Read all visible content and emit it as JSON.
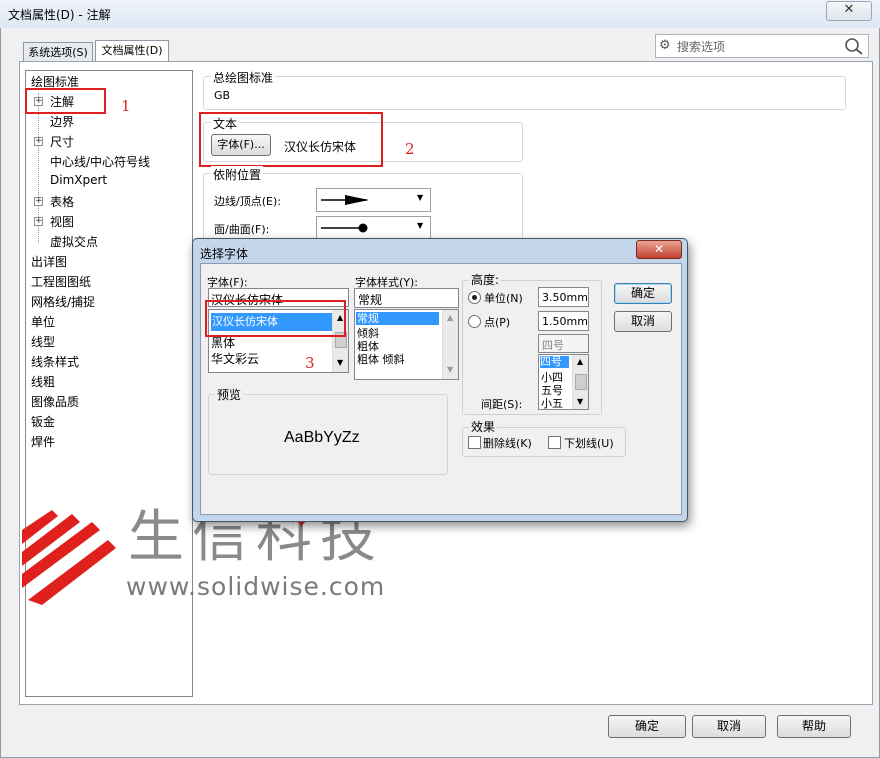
{
  "window": {
    "title": "文档属性(D) - 注解",
    "close_glyph": "✕"
  },
  "tabs": [
    {
      "label": "系统选项(S)"
    },
    {
      "label": "文档属性(D)"
    }
  ],
  "search": {
    "placeholder": "搜索选项"
  },
  "tree": {
    "items": [
      {
        "label": "绘图标准"
      },
      {
        "label": "注解"
      },
      {
        "label": "边界"
      },
      {
        "label": "尺寸"
      },
      {
        "label": "中心线/中心符号线"
      },
      {
        "label": "DimXpert"
      },
      {
        "label": "表格"
      },
      {
        "label": "视图"
      },
      {
        "label": "虚拟交点"
      },
      {
        "label": "出详图"
      },
      {
        "label": "工程图图纸"
      },
      {
        "label": "网格线/捕捉"
      },
      {
        "label": "单位"
      },
      {
        "label": "线型"
      },
      {
        "label": "线条样式"
      },
      {
        "label": "线粗"
      },
      {
        "label": "图像品质"
      },
      {
        "label": "钣金"
      },
      {
        "label": "焊件"
      }
    ]
  },
  "overall_standard": {
    "label": "总绘图标准",
    "value": "GB"
  },
  "text_group": {
    "label": "文本",
    "font_button": "字体(F)...",
    "font_name": "汉仪长仿宋体"
  },
  "attach_group": {
    "label": "依附位置",
    "edge_label": "边线/顶点(E):",
    "face_label": "面/曲面(F):"
  },
  "annotations": {
    "n1": "1",
    "n2": "2",
    "n3": "3"
  },
  "font_dialog": {
    "title": "选择字体",
    "close_glyph": "✕",
    "font_label": "字体(F):",
    "font_input": "汉仪长仿宋体",
    "font_list": [
      "汉仪长仿宋体",
      "黑体",
      "华文彩云"
    ],
    "style_label": "字体样式(Y):",
    "style_input": "常规",
    "style_list": [
      "常规",
      "倾斜",
      "粗体",
      "粗体 倾斜"
    ],
    "height_label": "高度:",
    "unit_label": "单位(N)",
    "unit_value": "3.50mm",
    "point_label": "点(P)",
    "point_value": "1.50mm",
    "size_input": "四号",
    "size_list": [
      "四号",
      "小四",
      "五号",
      "小五"
    ],
    "spacing_label": "间距(S):",
    "ok": "确定",
    "cancel": "取消",
    "preview_label": "预览",
    "preview_text": "AaBbYyZz",
    "effects_label": "效果",
    "strike_label": "删除线(K)",
    "underline_label": "下划线(U)"
  },
  "watermark": {
    "company": "生信科技",
    "url": "www.solidwise.com"
  },
  "footer": {
    "ok": "确定",
    "cancel": "取消",
    "help": "帮助"
  },
  "colors": {
    "annotation_red": "#e02020",
    "selection_blue": "#3399ff",
    "watermark_red": "#e0201c",
    "watermark_gray": "#8a8a8a"
  }
}
